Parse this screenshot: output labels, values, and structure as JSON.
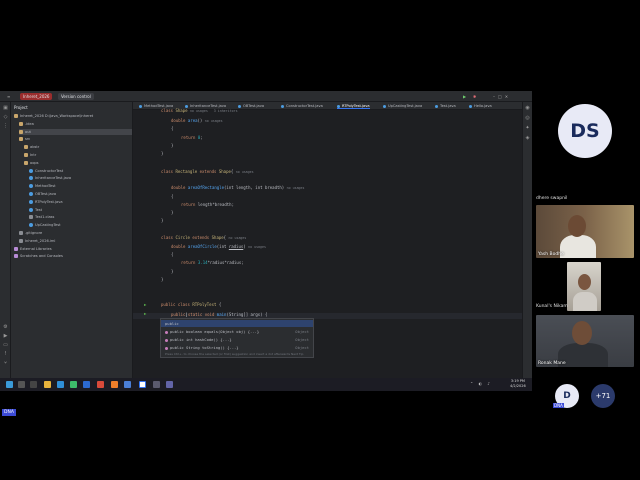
{
  "titlebar": {
    "project": "Inheret_2026",
    "vcs": "Version control",
    "run_icon": "run-icon",
    "debug_icon": "debug-icon"
  },
  "project_panel": {
    "header": "Project",
    "items": [
      {
        "label": "Inheret_2026  D:\\Java_Workspace\\Inheret",
        "type": "folder",
        "indent": 0
      },
      {
        "label": ".idea",
        "type": "folder",
        "indent": 1
      },
      {
        "label": "out",
        "type": "folder",
        "indent": 1,
        "selected": true
      },
      {
        "label": "src",
        "type": "folder",
        "indent": 1
      },
      {
        "label": "abstr",
        "type": "folder",
        "indent": 2
      },
      {
        "label": "Intr",
        "type": "folder",
        "indent": 2
      },
      {
        "label": "oops",
        "type": "folder",
        "indent": 2
      },
      {
        "label": "ConstructorTest",
        "type": "java",
        "indent": 3
      },
      {
        "label": "InheritanceTest.java",
        "type": "java",
        "indent": 3
      },
      {
        "label": "MethodTest",
        "type": "java",
        "indent": 3
      },
      {
        "label": "OBTest.java",
        "type": "java",
        "indent": 3
      },
      {
        "label": "RTPolyTest.java",
        "type": "java",
        "indent": 3
      },
      {
        "label": "Test",
        "type": "java",
        "indent": 3
      },
      {
        "label": "Test1.class",
        "type": "file",
        "indent": 3
      },
      {
        "label": "UpCastingTest",
        "type": "java",
        "indent": 3
      },
      {
        "label": ".gitignore",
        "type": "file",
        "indent": 1
      },
      {
        "label": "Inheret_2026.iml",
        "type": "file",
        "indent": 1
      },
      {
        "label": "External Libraries",
        "type": "lib",
        "indent": 0
      },
      {
        "label": "Scratches and Consoles",
        "type": "lib",
        "indent": 0
      }
    ]
  },
  "tabs": [
    {
      "label": "MethodTest.java"
    },
    {
      "label": "InheritanceTest.java"
    },
    {
      "label": "OBTest.java"
    },
    {
      "label": "ConstructorTest.java"
    },
    {
      "label": "RTPolyTest.java",
      "active": true
    },
    {
      "label": "UpCastingTest.java"
    },
    {
      "label": "Test.java"
    },
    {
      "label": "Hello.java"
    }
  ],
  "editor": {
    "lines": {
      "l1_kw": "class",
      "l1_name": "Shape",
      "l1_hint": "no usages   3 inheritors",
      "l2_type": "double",
      "l2_fn": "area",
      "l2_rest": "()",
      "l2_hint": "no usages",
      "l3": "{",
      "l4_kw": "return",
      "l4_num": "0",
      "l4_end": ";",
      "l5": "}",
      "l6": "}",
      "l7_kw": "class",
      "l7_name": "Rectangle",
      "l7_kw2": "extends",
      "l7_parent": "Shape",
      "l7_rest": "{",
      "l7_hint": "no usages",
      "l8_type": "double",
      "l8_fn": "areaOfRectangle",
      "l8_rest": "(int length, int breadth)",
      "l8_hint": "no usages",
      "l9": "{",
      "l10_kw": "return",
      "l10_rest": "length*breadth;",
      "l11": "}",
      "l12": "}",
      "l13_kw": "class",
      "l13_name": "Circle",
      "l13_kw2": "extends",
      "l13_parent": "Shape",
      "l13_rest": "{",
      "l13_hint": "no usages",
      "l14_type": "double",
      "l14_fn": "areaOfCircle",
      "l14_open": "(int ",
      "l14_param": "radius",
      "l14_close": ")",
      "l14_hint": "no usages",
      "l15": "{",
      "l16_kw": "return",
      "l16_num": "3.14",
      "l16_rest": "*radius*radius;",
      "l17": "}",
      "l18": "}",
      "l19_kw": "public class",
      "l19_name": "RTPolyTest",
      "l19_rest": "{",
      "l20_kw": "public",
      "l20_caret": "|",
      "l20_kw2": "static void",
      "l20_fn": "main",
      "l20_rest": "(String[] args) {"
    }
  },
  "completion": {
    "items": [
      {
        "label": "public",
        "type": ""
      },
      {
        "label": "public boolean equals(Object obj) {...}",
        "type": "Object"
      },
      {
        "label": "public int hashCode() {...}",
        "type": "Object"
      },
      {
        "label": "public String toString() {...}",
        "type": "Object"
      }
    ],
    "footer": "Press Ctrl+. to choose the selected (or first) suggestion and insert a dot afterwards  Next Tip"
  },
  "statusbar": {
    "project": "Inheret_2026",
    "path_src": "src",
    "path_pkg": "oops",
    "path_file": "RTPolyTest",
    "path_class": "RTPolyTest",
    "position": "27:11",
    "line_sep": "CRLF",
    "encoding": "UTF-8",
    "badge": "IH",
    "project2": "Inheret_2026",
    "material": "Material Darker",
    "indent": "4 spaces"
  },
  "taskbar": {
    "time": "3:19 PM",
    "date": "4/2/2026"
  },
  "meeting": {
    "presenter_initials": "DS",
    "presenter_name": "dhere swapnil",
    "participants": [
      {
        "name": "Yash Bodhe"
      },
      {
        "name": "Kunal's Nikam"
      },
      {
        "name": "Ronak Mane"
      }
    ],
    "self_initial": "D",
    "self_tag": "DNA",
    "more_count": "+71",
    "self_label": "DNA"
  },
  "colors": {
    "ide_bg": "#1e1f22",
    "ide_panel": "#2b2d30",
    "keyword": "#cf8e6d",
    "function": "#56a8f5",
    "accent": "#3574f0",
    "project_badge": "#9b2d2d"
  }
}
